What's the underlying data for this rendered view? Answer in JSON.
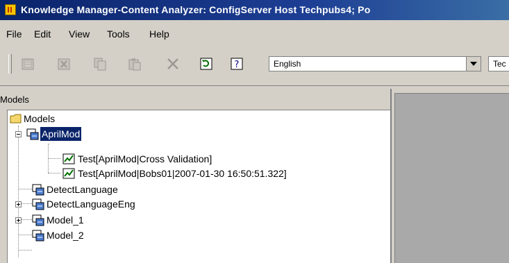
{
  "window": {
    "title": "Knowledge Manager-Content Analyzer: ConfigServer Host Techpubs4; Po"
  },
  "menu": {
    "file": "File",
    "edit": "Edit",
    "view": "View",
    "tools": "Tools",
    "help": "Help"
  },
  "toolbar": {
    "buttons": [
      {
        "icon": "new-document-icon",
        "enabled": false
      },
      {
        "icon": "cut-icon",
        "enabled": false
      },
      {
        "icon": "copy-icon",
        "enabled": false
      },
      {
        "icon": "paste-icon",
        "enabled": false
      },
      {
        "icon": "delete-x-icon",
        "enabled": false
      },
      {
        "icon": "refresh-icon",
        "enabled": true
      },
      {
        "icon": "query-icon",
        "enabled": true
      }
    ],
    "language_value": "English",
    "second_combo_value": "Tec"
  },
  "models_panel": {
    "title": "Models",
    "tree": {
      "root": "Models",
      "nodes": [
        {
          "label": "AprilMod",
          "selected": true,
          "expanded": true,
          "children": [
            "Test[AprilMod|Cross Validation]",
            "Test[AprilMod|Bobs01|2007-01-30 16:50:51.322]"
          ]
        },
        {
          "label": "DetectLanguage"
        },
        {
          "label": "DetectLanguageEng",
          "collapsed": true
        },
        {
          "label": "Model_1",
          "collapsed": true
        },
        {
          "label": "Model_2"
        }
      ]
    }
  },
  "colors": {
    "titlebar": "#0a246a",
    "chrome": "#d4d0c8",
    "selection": "#0a246a"
  }
}
